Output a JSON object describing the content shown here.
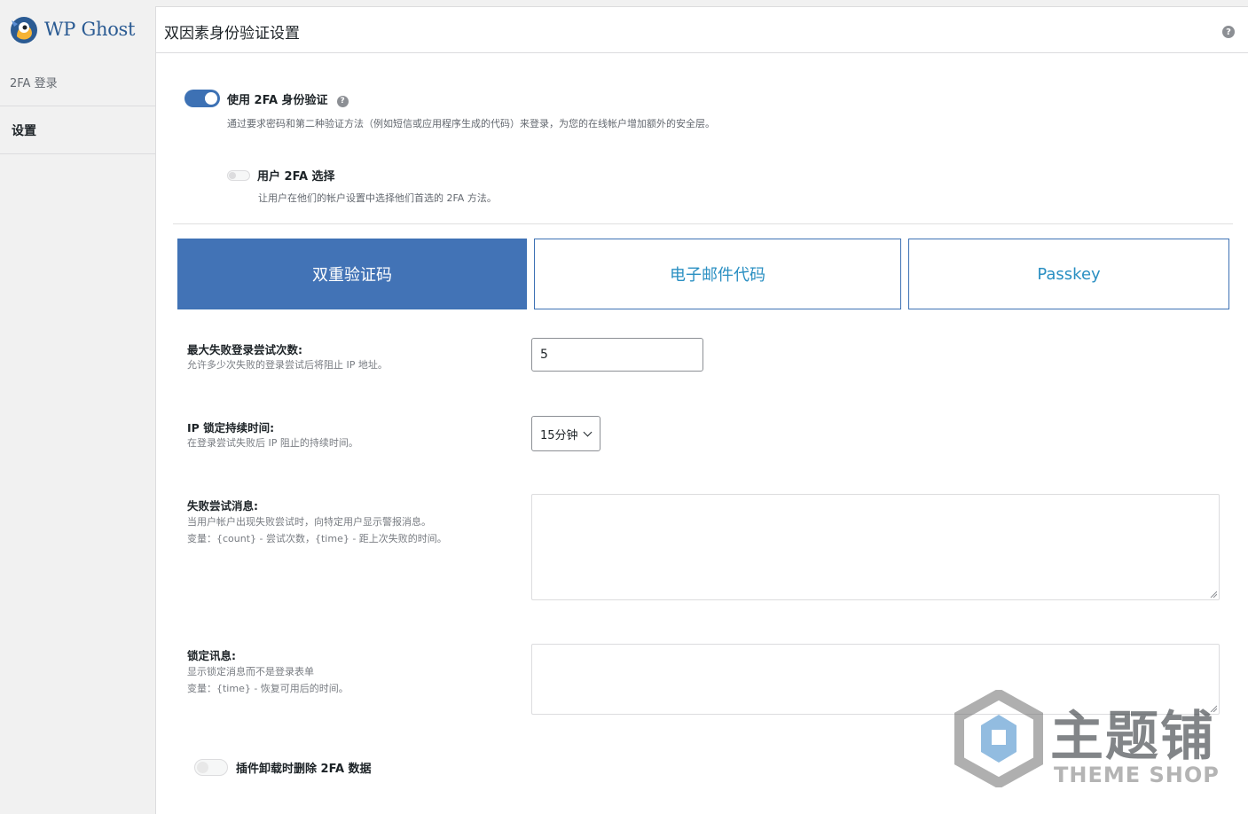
{
  "brand": {
    "name": "WP Ghost"
  },
  "sidebar": {
    "items": [
      {
        "label": "2FA 登录"
      },
      {
        "label": "设置"
      }
    ]
  },
  "header": {
    "title": "双因素身份验证设置",
    "help": "?"
  },
  "toggles": {
    "use_2fa": {
      "label": "使用 2FA 身份验证",
      "help": "?",
      "description": "通过要求密码和第二种验证方法（例如短信或应用程序生成的代码）来登录，为您的在线帐户增加额外的安全层。",
      "state": "on"
    },
    "user_choice": {
      "label": "用户 2FA 选择",
      "description": "让用户在他们的帐户设置中选择他们首选的 2FA 方法。",
      "state": "off"
    },
    "delete_on_uninstall": {
      "label": "插件卸载时删除 2FA 数据",
      "state": "off"
    }
  },
  "tabs": [
    {
      "label": "双重验证码",
      "active": true
    },
    {
      "label": "电子邮件代码",
      "active": false
    },
    {
      "label": "Passkey",
      "active": false
    }
  ],
  "form": {
    "max_attempts": {
      "label": "最大失败登录尝试次数:",
      "description": "允许多少次失败的登录尝试后将阻止 IP 地址。",
      "value": "5"
    },
    "lockout_duration": {
      "label": "IP 锁定持续时间:",
      "description": "在登录尝试失败后 IP 阻止的持续时间。",
      "value": "15分钟"
    },
    "fail_message": {
      "label": "失败尝试消息:",
      "description_1": "当用户帐户出现失败尝试时，向特定用户显示警报消息。",
      "description_2": "变量：{count} - 尝试次数，{time} - 距上次失败的时间。",
      "value": ""
    },
    "lockout_message": {
      "label": "锁定讯息:",
      "description_1": "显示锁定消息而不是登录表单",
      "description_2": "变量：{time} - 恢复可用后的时间。",
      "value": ""
    }
  },
  "watermark": {
    "text_cn": "主题铺",
    "text_en": "THEME SHOP"
  },
  "colors": {
    "accent": "#4273b6",
    "tab_text": "#2a8fc2",
    "border": "#dcdcde"
  }
}
